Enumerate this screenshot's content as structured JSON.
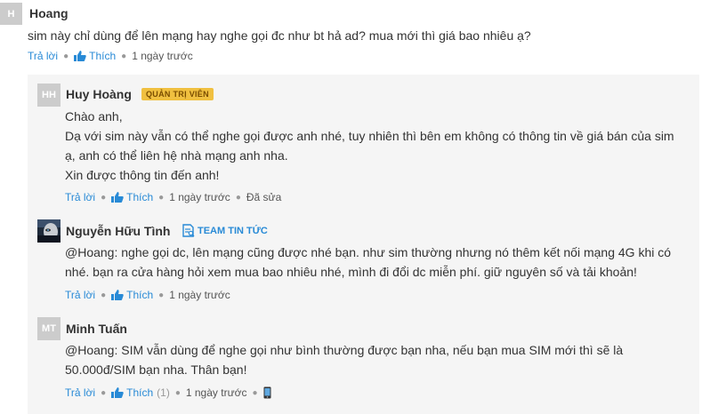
{
  "comments": {
    "top": {
      "avatar": "H",
      "name": "Hoang",
      "text": "sim này chỉ dùng để lên mạng hay nghe gọi đc như bt hả ad? mua mới thì giá bao nhiêu ạ?",
      "reply_label": "Trả lời",
      "like_label": "Thích",
      "time": "1 ngày trước"
    },
    "replies": [
      {
        "avatar": "HH",
        "name": "Huy Hoàng",
        "badge": "QUẢN TRỊ VIÊN",
        "lines": [
          "Chào anh,",
          "Dạ với sim này vẫn có thể nghe gọi được anh nhé, tuy nhiên thì bên em không có thông tin về giá bán của sim",
          "ạ, anh có thể liên hệ nhà mạng anh nha.",
          "Xin được thông tin đến anh!"
        ],
        "reply_label": "Trả lời",
        "like_label": "Thích",
        "time": "1 ngày trước",
        "edited": "Đã sửa"
      },
      {
        "avatar_icon": "user-photo-avatar",
        "name": "Nguyễn Hữu Tình",
        "badge": "TEAM TIN TỨC",
        "badge_icon": "news-document-icon",
        "lines": [
          "@Hoang: nghe gọi dc, lên mạng cũng được nhé bạn. như sim thường nhưng nó thêm kết nối mạng 4G khi có",
          "nhé. bạn ra cửa hàng hỏi xem mua bao nhiêu nhé, mình đi đổi dc miễn phí. giữ nguyên số và tải khoản!"
        ],
        "reply_label": "Trả lời",
        "like_label": "Thích",
        "time": "1 ngày trước"
      },
      {
        "avatar": "MT",
        "name": "Minh Tuấn",
        "lines": [
          "@Hoang: SIM vẫn dùng để nghe gọi như bình thường được bạn nha, nếu bạn mua SIM mới thì sẽ là",
          "50.000đ/SIM bạn nha. Thân bạn!"
        ],
        "reply_label": "Trả lời",
        "like_label": "Thích",
        "like_count": "(1)",
        "time": "1 ngày trước",
        "device_icon": "mobile-phone-icon"
      }
    ]
  },
  "colors": {
    "link": "#288ad6",
    "badge_admin_bg": "#f0c040",
    "reply_bg": "#f5f5f5",
    "avatar_bg": "#cccccc"
  }
}
